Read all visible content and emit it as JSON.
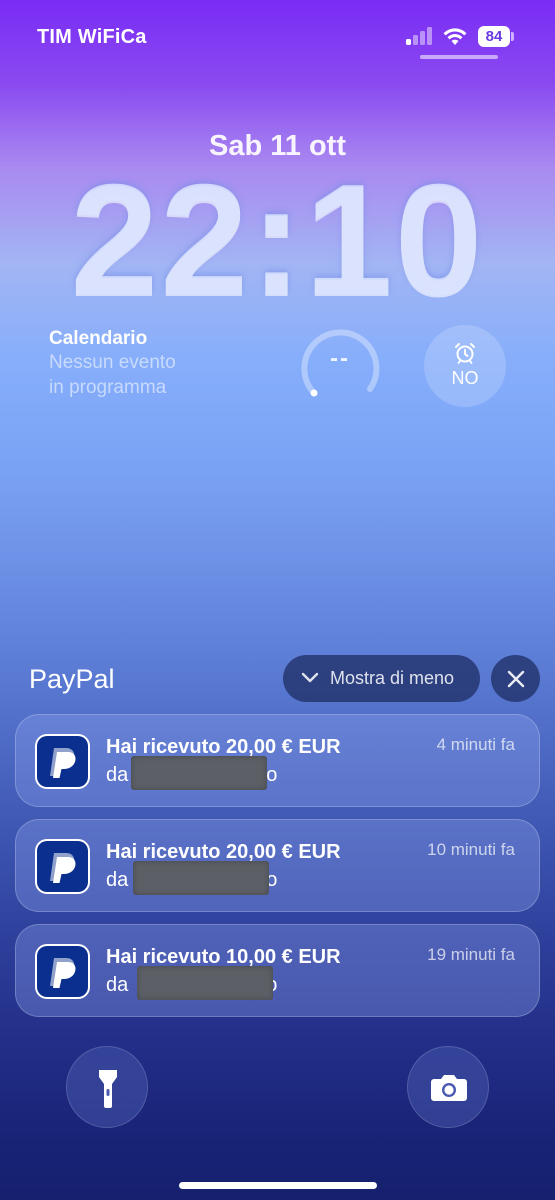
{
  "status_bar": {
    "carrier": "TIM WiFiCa",
    "battery": "84",
    "icons": [
      "signal-icon",
      "wifi-icon",
      "battery-icon"
    ]
  },
  "lock_screen": {
    "date": "Sab 11 ott",
    "time": "22:10"
  },
  "widgets": {
    "calendar": {
      "title": "Calendario",
      "line1": "Nessun evento",
      "line2": "in programma"
    },
    "gauge": {
      "value": "--"
    },
    "alarm": {
      "label": "NO",
      "icon": "alarm-clock-icon"
    }
  },
  "notification_group": {
    "app_name": "PayPal",
    "show_less_label": "Mostra di meno",
    "items": [
      {
        "title": "Hai ricevuto 20,00 € EUR",
        "prefix": "da",
        "suffix": "o",
        "time_ago": "4 minuti fa"
      },
      {
        "title": "Hai ricevuto 20,00 € EUR",
        "prefix": "da",
        "suffix": "o",
        "time_ago": "10 minuti fa"
      },
      {
        "title": "Hai ricevuto 10,00 € EUR",
        "prefix": "da",
        "suffix": "o",
        "time_ago": "19 minuti fa"
      }
    ]
  },
  "bottom_controls": {
    "left": "flashlight-icon",
    "right": "camera-icon"
  },
  "colors": {
    "gradient_top": "#7a2cf5",
    "gradient_bottom": "#15206e",
    "paypal_blue": "#0a2f8f"
  }
}
